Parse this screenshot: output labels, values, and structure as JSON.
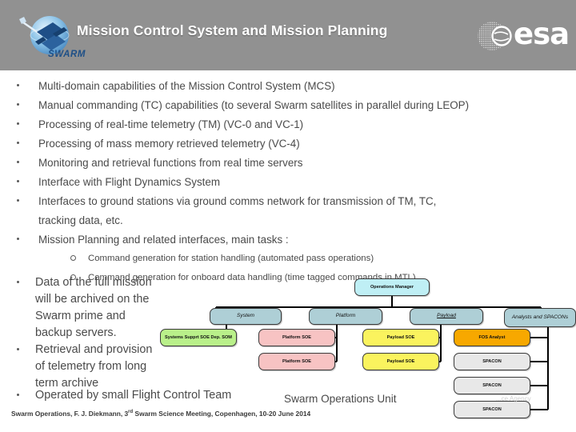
{
  "header": {
    "title": "Mission Control System and Mission Planning",
    "swarm_logo_label": "SWARM",
    "esa_logo_label": "esa"
  },
  "bullets": [
    {
      "level": 1,
      "text": "Multi-domain capabilities of the Mission Control System (MCS)"
    },
    {
      "level": 1,
      "text": "Manual commanding (TC) capabilities (to several Swarm satellites in parallel during LEOP)"
    },
    {
      "level": 1,
      "text": "Processing of real-time telemetry (TM) (VC-0 and VC-1)"
    },
    {
      "level": 1,
      "text": "Processing of mass memory retrieved telemetry (VC-4)"
    },
    {
      "level": 1,
      "text": "Monitoring and retrieval functions from real time servers"
    },
    {
      "level": 1,
      "text": "Interface with Flight Dynamics System"
    },
    {
      "level": 1,
      "text": "Interfaces to ground stations via ground comms network for transmission of TM, TC,"
    },
    {
      "level": 1,
      "continuation": true,
      "text": "tracking data, etc."
    },
    {
      "level": 1,
      "text": "Mission Planning and related interfaces, main tasks :"
    },
    {
      "level": 2,
      "text": "Command generation for station handling (automated pass operations)"
    },
    {
      "level": 2,
      "text": "Command generation for onboard data handling (time tagged commands in MTL)"
    }
  ],
  "lower_bullets": [
    {
      "lines": [
        "Data of the full mission",
        "will be archived on the",
        "Swarm prime and",
        "backup servers."
      ]
    },
    {
      "lines": [
        "Retrieval and provision",
        "of telemetry from long",
        "term archive"
      ]
    }
  ],
  "final_bullet": {
    "lines": [
      "Operated by small Flight Control Team"
    ]
  },
  "chart_label": "Swarm Operations Unit",
  "footer": {
    "text_before": "Swarm Operations,  F. J. Diekmann, 3",
    "sup": "rd",
    "text_after": " Swarm Science Meeting, Copenhagen, 10-20 June 2014"
  },
  "watermark": "...ce Agency",
  "org_chart": {
    "root": "Operations Manager",
    "categories": [
      "System",
      "Platform",
      "Payload",
      "Analysts and SPACONs"
    ],
    "columns": [
      {
        "category": "System",
        "members": [
          "Systems Supprt SOE Dep. SOM"
        ]
      },
      {
        "category": "Platform",
        "members": [
          "Platform SOE",
          "Platform SOE"
        ]
      },
      {
        "category": "Payload",
        "members": [
          "Payload SOE",
          "Payload SOE"
        ]
      },
      {
        "category": "Analysts and SPACONs",
        "members": [
          "FOS Analyst",
          "SPACON",
          "SPACON",
          "SPACON"
        ]
      }
    ],
    "colors": {
      "root": "#bfeff5",
      "category": "#aecfd6",
      "system_member": "#b9f08a",
      "platform_member": "#f7c3c3",
      "payload_member": "#faf35e",
      "analyst": "#f7a800",
      "spacon": "#e8e8e8"
    }
  }
}
